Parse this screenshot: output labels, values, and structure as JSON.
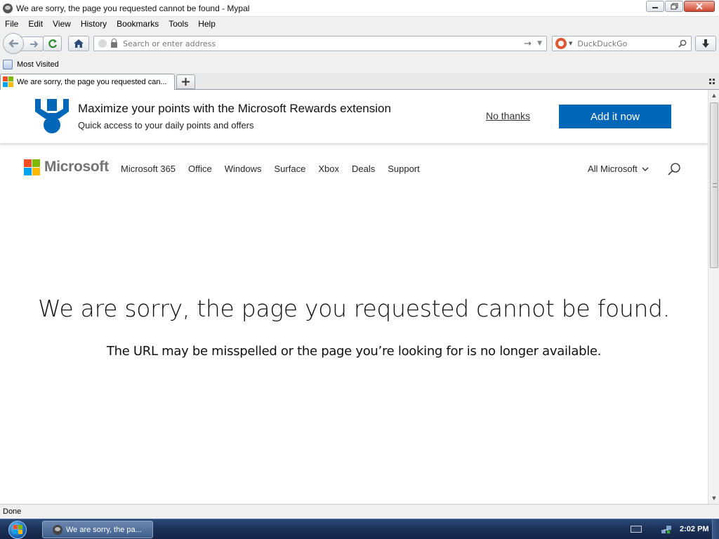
{
  "window": {
    "title": "We are sorry, the page you requested cannot be found - Mypal",
    "buttons": {
      "minimize_icon": "minimize-icon",
      "maximize_icon": "restore-icon",
      "close_icon": "close-icon"
    }
  },
  "menubar": [
    "File",
    "Edit",
    "View",
    "History",
    "Bookmarks",
    "Tools",
    "Help"
  ],
  "navbar": {
    "url_placeholder": "Search or enter address",
    "url_value": "",
    "search_engine": "DuckDuckGo",
    "search_placeholder": "DuckDuckGo"
  },
  "bookmarks": {
    "items": [
      {
        "label": "Most Visited",
        "icon": "bookmark-folder-icon"
      }
    ]
  },
  "tabs": [
    {
      "label": "We are sorry, the page you requested can...",
      "favicon": "microsoft-favicon",
      "active": true
    }
  ],
  "banner": {
    "heading": "Maximize your points with the Microsoft Rewards extension",
    "subheading": "Quick access to your daily points and offers",
    "decline_label": "No thanks",
    "accept_label": "Add it now",
    "accent": "#0067b8"
  },
  "site_nav": {
    "brand": "Microsoft",
    "links": [
      "Microsoft 365",
      "Office",
      "Windows",
      "Surface",
      "Xbox",
      "Deals",
      "Support"
    ],
    "all_label": "All Microsoft",
    "logo_colors": [
      "#f25022",
      "#7fba00",
      "#00a4ef",
      "#ffb900"
    ]
  },
  "error": {
    "title": "We are sorry, the page you requested cannot be found.",
    "message": "The URL may be misspelled or the page you’re looking for is no longer available."
  },
  "statusbar": {
    "text": "Done"
  },
  "taskbar": {
    "window_label": "We are sorry, the pa...",
    "clock": "2:02 PM"
  }
}
